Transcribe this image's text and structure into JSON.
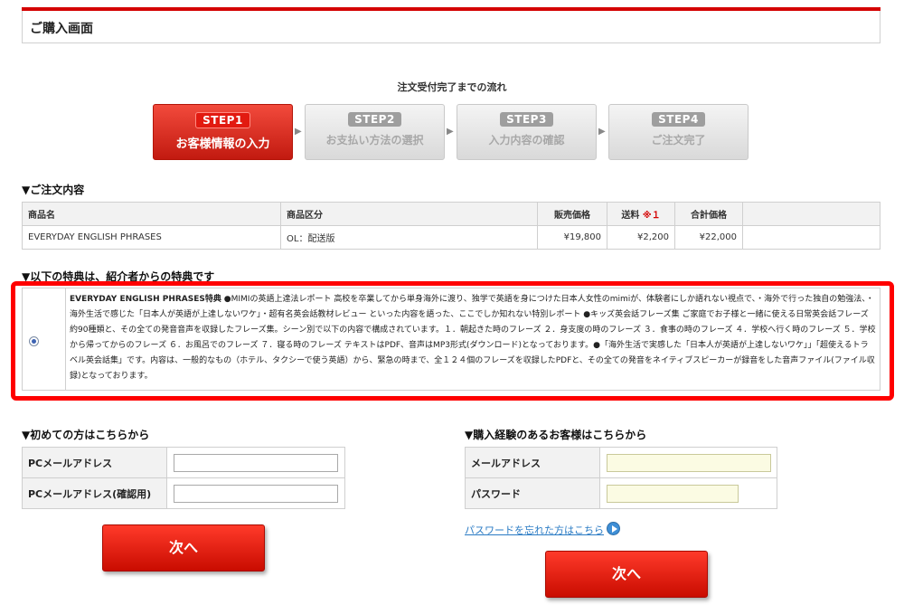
{
  "header": {
    "title": "ご購入画面"
  },
  "flow": {
    "title": "注文受付完了までの流れ",
    "steps": [
      {
        "badge": "STEP1",
        "label": "お客様情報の入力",
        "active": true
      },
      {
        "badge": "STEP2",
        "label": "お支払い方法の選択",
        "active": false
      },
      {
        "badge": "STEP3",
        "label": "入力内容の確認",
        "active": false
      },
      {
        "badge": "STEP4",
        "label": "ご注文完了",
        "active": false
      }
    ]
  },
  "order": {
    "title": "▼ご注文内容",
    "headers": {
      "name": "商品名",
      "category": "商品区分",
      "price": "販売価格",
      "shipping": "送料",
      "shipping_mark": "※１",
      "total": "合計価格"
    },
    "rows": [
      {
        "name": "EVERYDAY ENGLISH PHRASES",
        "category": "OL：配送版",
        "price": "¥19,800",
        "shipping": "¥2,200",
        "total": "¥22,000"
      }
    ]
  },
  "bonus": {
    "title": "▼以下の特典は、紹介者からの特典です",
    "selected": true,
    "heading": "EVERYDAY ENGLISH PHRASES特典",
    "body": "●MIMIの英語上達法レポート 高校を卒業してから単身海外に渡り、独学で英語を身につけた日本人女性のmimiが、体験者にしか語れない視点で、・海外で行った独自の勉強法、・海外生活で感じた「日本人が英語が上達しないワケ」・超有名英会話教材レビュー といった内容を語った、ここでしか知れない特別レポート ●キッズ英会話フレーズ集 ご家庭でお子様と一緒に使える日常英会話フレーズ約90種類と、その全ての発音音声を収録したフレーズ集。シーン別で以下の内容で構成されています。１．朝起きた時のフレーズ ２．身支度の時のフレーズ ３．食事の時のフレーズ ４．学校へ行く時のフレーズ ５．学校から帰ってからのフレーズ ６．お風呂でのフレーズ ７．寝る時のフレーズ テキストはPDF、音声はMP3形式(ダウンロード)となっております。●「海外生活で実感した「日本人が英語が上達しないワケ」」「超使えるトラベル英会話集」です。内容は、一般的なもの（ホテル、タクシーで使う英語）から、緊急の時まで、全１２４個のフレーズを収録したPDFと、その全ての発音をネイティブスピーカーが録音をした音声ファイル(ファイル収録)となっております。"
  },
  "new_customer": {
    "title": "▼初めての方はこちらから",
    "email_label": "PCメールアドレス",
    "email_value": "",
    "confirm_label": "PCメールアドレス(確認用)",
    "confirm_value": "",
    "next_label": "次へ"
  },
  "returning_customer": {
    "title": "▼購入経験のあるお客様はこちらから",
    "email_label": "メールアドレス",
    "email_value": "",
    "password_label": "パスワード",
    "password_value": "",
    "forgot_label": "パスワードを忘れた方はこちら",
    "next_label": "次へ"
  },
  "colors": {
    "accent": "#d40000",
    "button": "#e5140a",
    "link": "#2a7bc4",
    "highlight_frame": "#ff0000"
  },
  "icons": {
    "forgot": "circle-arrow-right-icon",
    "step_arrow": "triangle-right-icon",
    "radio": "radio-selected-icon"
  }
}
